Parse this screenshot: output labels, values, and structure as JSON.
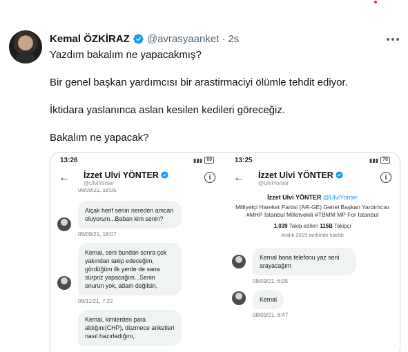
{
  "tweet": {
    "author_name": "Kemal ÖZKİRAZ",
    "author_handle": "@avrasyaanket",
    "separator": "·",
    "time": "2s",
    "lines": [
      "Yazdım bakalım ne yapacakmış?",
      "Bir genel başkan yardımcısı bir arastirmaciyi ölümle tehdit ediyor.",
      "İktidara yaslanınca aslan kesilen kedileri göreceğiz.",
      "Bakalım ne yapacak?"
    ]
  },
  "colors": {
    "verified": "#1d9bf0",
    "text": "#0f1419",
    "muted": "#536471",
    "border": "#cfd9de"
  },
  "icons": {
    "verified": "verified-badge-icon",
    "more": "more-dots-icon",
    "back": "back-arrow-icon",
    "info": "info-icon"
  },
  "screenshot_left": {
    "status_time": "13:26",
    "battery": "69",
    "profile_name": "İzzet Ulvi YÖNTER",
    "profile_handle": "@UlviYonter",
    "top_cut_stamp": "08/09/21, 18:05",
    "messages": [
      {
        "text": "Alçak herif senin nereden amcan oluyorum...Baban kim senin?",
        "stamp": "08/09/21, 18:07"
      },
      {
        "text": "Kemal, seni bundan sonra çok yakından takip edeceğim, gördüğüm ilk yerde de sana sürpriz yapacağım...Senin onurun yok, adam değilsin,",
        "stamp": "08/11/21, 7:22"
      },
      {
        "text": "Kemal, kimlerden para aldığını(CHP), düzmece anketleri nasıl hazırladığını,",
        "stamp": ""
      }
    ]
  },
  "screenshot_right": {
    "status_time": "13:25",
    "battery": "70",
    "profile_name": "İzzet Ulvi YÖNTER",
    "profile_handle": "@UlviYonter",
    "bio_name": "İzzet Ulvi YÖNTER",
    "bio_handle": "@UlviYonter",
    "bio_desc": "Milliyetçi Hareket Partisi (AR-GE) Genel Başkan Yardımcısı #MHP İstanbul Milletvekili #TBMM MP For İstanbul",
    "following_count": "1.039",
    "following_label": "Takip edilen",
    "followers_count": "115B",
    "followers_label": "Takipçi",
    "joined": "Aralık 2015 tarihinde katıldı",
    "messages": [
      {
        "text": "Kemal bana telefonu yaz seni arayacağım",
        "stamp": "08/09/21, 6:05"
      },
      {
        "text": "Kemal",
        "stamp": "08/09/21, 8:47"
      }
    ]
  }
}
